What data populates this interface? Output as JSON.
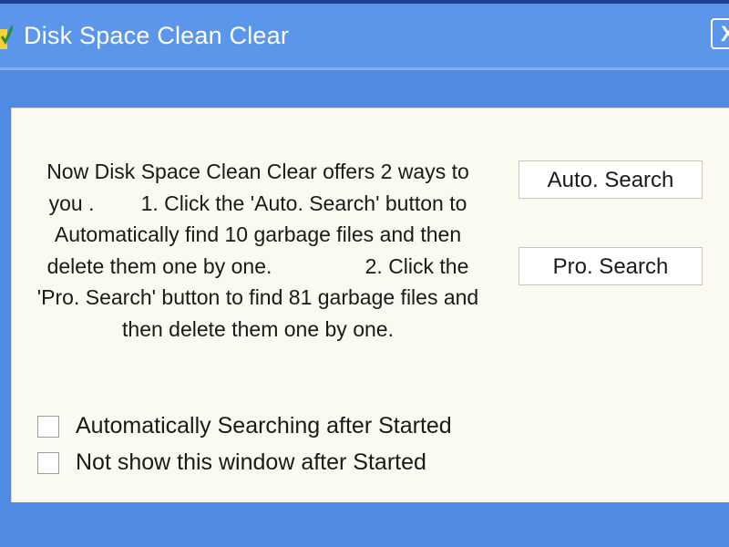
{
  "window": {
    "title": "Disk Space Clean Clear",
    "close_label": "X",
    "app_icon": "broom-check-icon",
    "close_icon": "close-icon"
  },
  "colors": {
    "titlebar": "#5b96eb",
    "frame": "#4f8be3",
    "panel": "#fbfaf1",
    "text": "#1a1a1a"
  },
  "content": {
    "description": "Now Disk Space Clean Clear offers 2 ways to you .        1. Click the 'Auto. Search' button to Automatically find 10 garbage files and then delete them one by one.                2. Click the 'Pro. Search' button to find 81 garbage files and then delete them one by one.",
    "auto_search_label": "Auto. Search",
    "pro_search_label": "Pro. Search"
  },
  "options": [
    {
      "label": "Automatically Searching after Started",
      "checked": false
    },
    {
      "label": "Not show this window after Started",
      "checked": false
    }
  ]
}
